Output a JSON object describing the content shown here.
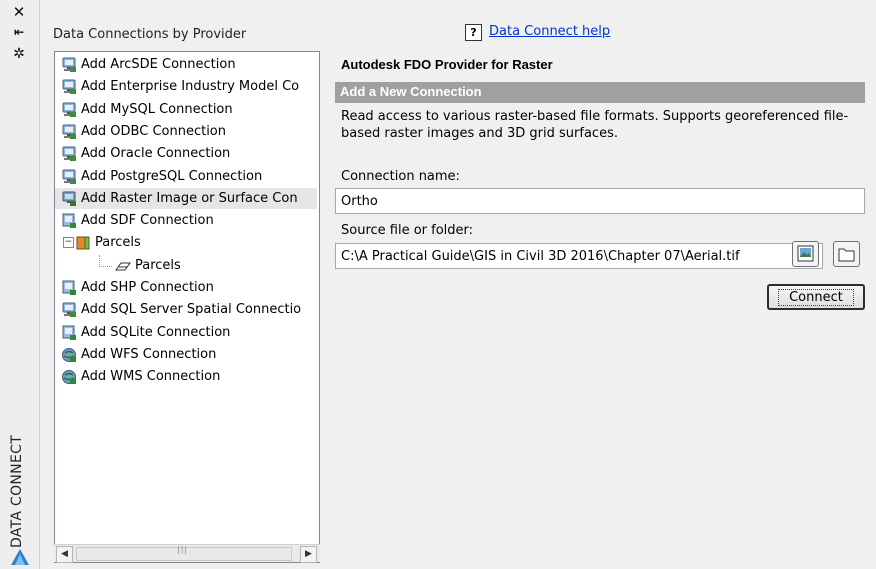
{
  "sidebar": {
    "label": "DATA CONNECT"
  },
  "panel": {
    "title": "Data Connections by Provider",
    "help_icon": "?",
    "help_link": "Data Connect help"
  },
  "tree": [
    {
      "label": "Add ArcSDE Connection",
      "icon": "database-connection-icon"
    },
    {
      "label": "Add Enterprise Industry Model Co",
      "icon": "database-connection-icon"
    },
    {
      "label": "Add MySQL Connection",
      "icon": "database-connection-icon"
    },
    {
      "label": "Add ODBC Connection",
      "icon": "database-connection-icon"
    },
    {
      "label": "Add Oracle Connection",
      "icon": "database-connection-icon"
    },
    {
      "label": "Add PostgreSQL Connection",
      "icon": "database-connection-icon"
    },
    {
      "label": "Add Raster Image or Surface Con",
      "icon": "raster-connection-icon",
      "selected": true
    },
    {
      "label": "Add SDF Connection",
      "icon": "file-connection-icon"
    },
    {
      "label": "Parcels",
      "icon": "feature-source-icon",
      "expanded": true,
      "indent": 1
    },
    {
      "label": "Parcels",
      "icon": "polygon-layer-icon",
      "indent": 2
    },
    {
      "label": "Add SHP Connection",
      "icon": "file-connection-icon"
    },
    {
      "label": "Add SQL Server Spatial Connectio",
      "icon": "database-connection-icon"
    },
    {
      "label": "Add SQLite Connection",
      "icon": "file-connection-icon"
    },
    {
      "label": "Add WFS Connection",
      "icon": "web-service-icon"
    },
    {
      "label": "Add WMS Connection",
      "icon": "web-service-icon"
    }
  ],
  "detail": {
    "provider_title": "Autodesk FDO Provider for Raster",
    "section_title": "Add a New Connection",
    "description": "Read access to various raster-based file formats. Supports georeferenced file-based raster images and 3D grid surfaces.",
    "connection_name_label": "Connection name:",
    "connection_name_value": "Ortho",
    "source_label": "Source file or folder:",
    "source_value": "C:\\A Practical Guide\\GIS in Civil 3D 2016\\Chapter 07\\Aerial.tif",
    "connect_label": "Connect"
  },
  "colors": {
    "section_bar": "#a0a0a0",
    "selected_row": "#e6e6e6",
    "link": "#0033cc"
  }
}
